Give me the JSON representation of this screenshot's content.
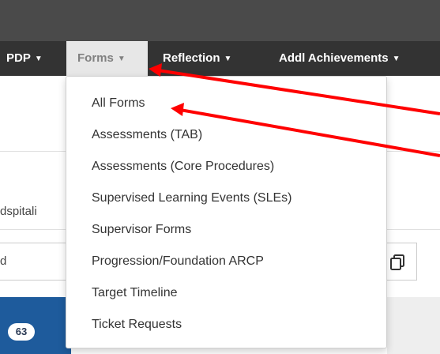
{
  "nav": {
    "items": [
      {
        "label": "PDP"
      },
      {
        "label": "Forms"
      },
      {
        "label": "Reflection"
      },
      {
        "label": "Addl Achievements"
      }
    ],
    "active": "Forms"
  },
  "page": {
    "left_text": "dspitali",
    "input_value": "d",
    "badge_count": "63"
  },
  "dropdown": {
    "items": [
      {
        "label": "All Forms"
      },
      {
        "label": "Assessments (TAB)"
      },
      {
        "label": "Assessments (Core Procedures)"
      },
      {
        "label": "Supervised Learning Events (SLEs)"
      },
      {
        "label": "Supervisor Forms"
      },
      {
        "label": "Progression/Foundation ARCP"
      },
      {
        "label": "Target Timeline"
      },
      {
        "label": "Ticket Requests"
      }
    ]
  },
  "colors": {
    "topbar": "#4a4a4a",
    "navbar": "#333333",
    "active_tab": "#e7e7e7",
    "blue_band": "#1e5b9c",
    "annotation_arrow": "#ff0000"
  },
  "icons": [
    "caret-down-icon",
    "copy-icon"
  ]
}
